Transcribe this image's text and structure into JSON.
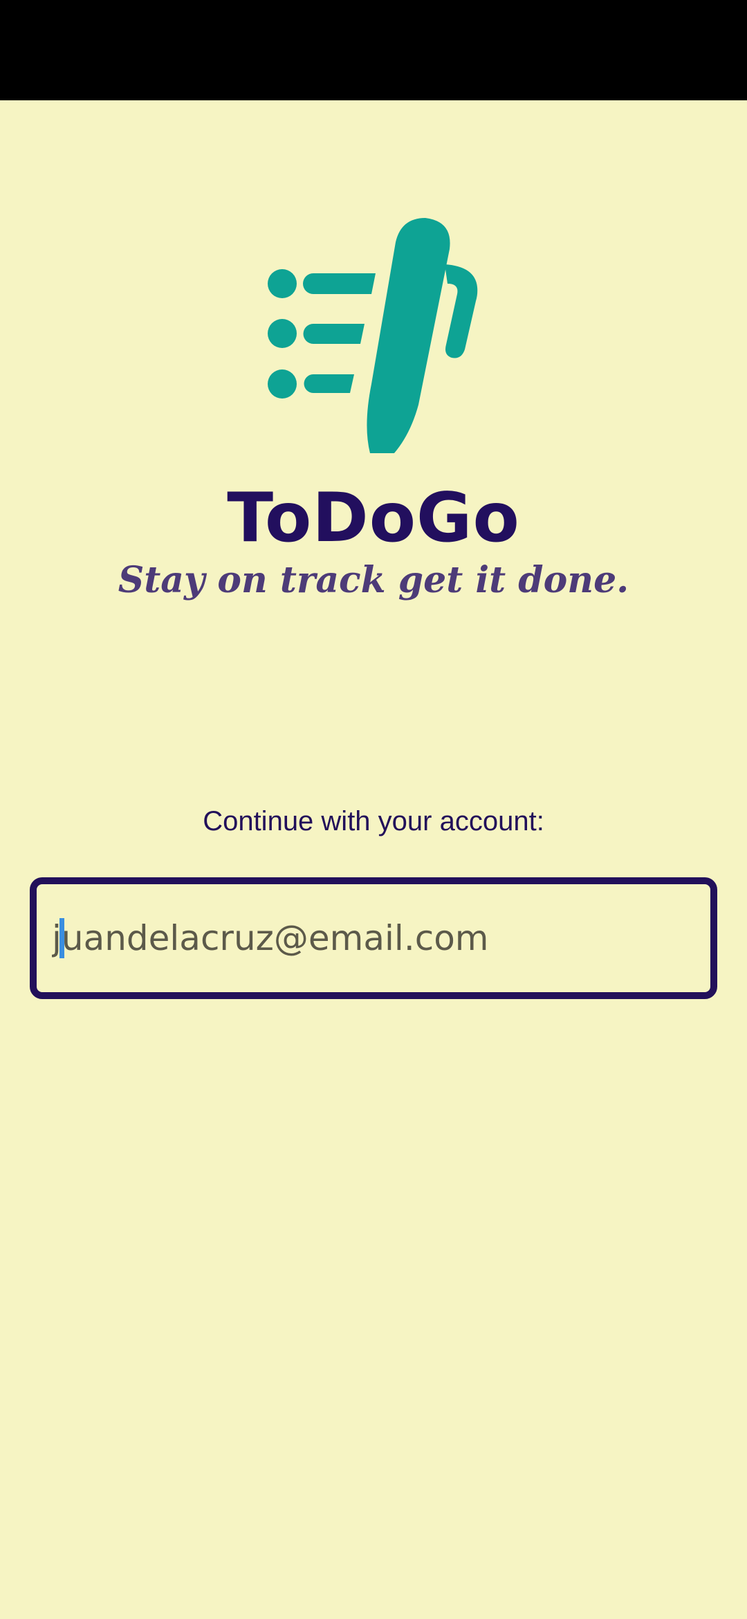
{
  "app": {
    "title": "ToDoGo",
    "tagline": "Stay on track get it done.",
    "logo_icon": "checklist-pen-icon"
  },
  "login": {
    "prompt": "Continue with your account:",
    "email_placeholder": "juandelacruz@email.com",
    "email_value": ""
  },
  "colors": {
    "background": "#f6f4c3",
    "status_bar": "#000000",
    "logo": "#0ea394",
    "title": "#220f5e",
    "tagline": "#4d3b78",
    "field_border": "#22105a",
    "caret": "#3a8ee0"
  }
}
